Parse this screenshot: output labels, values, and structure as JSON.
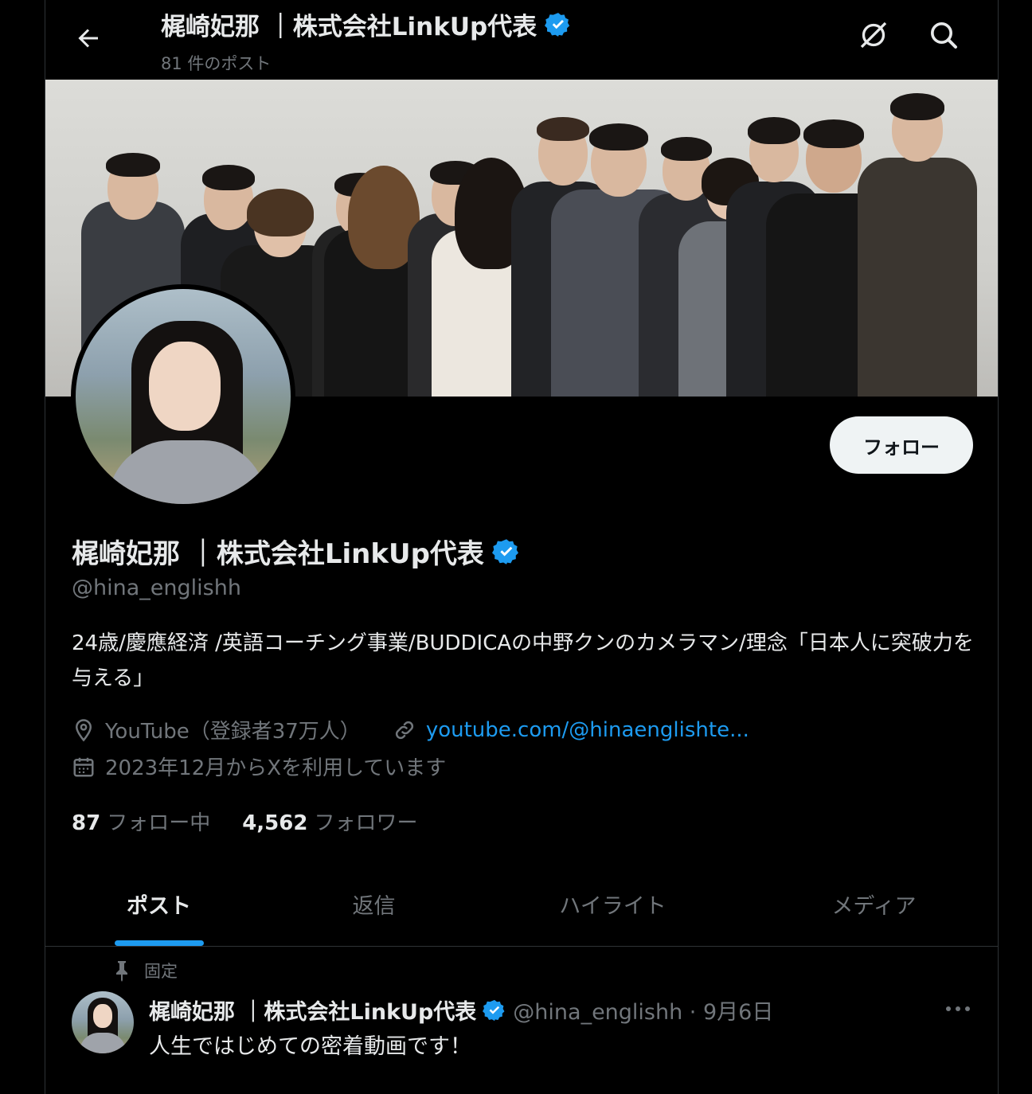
{
  "header": {
    "title": "梶崎妃那 ｜株式会社LinkUp代表",
    "post_count": "81 件のポスト",
    "back_icon": "arrow-left-icon",
    "grok_icon": "grok-icon",
    "search_icon": "search-icon"
  },
  "profile": {
    "name": "梶崎妃那 ｜株式会社LinkUp代表",
    "handle": "@hina_englishh",
    "bio": "24歳/慶應経済 /英語コーチング事業/BUDDICAの中野クンのカメラマン/理念「日本人に突破力を与える」",
    "location": "YouTube（登録者37万人）",
    "website": "youtube.com/@hinaenglishte...",
    "joined": "2023年12月からXを利用しています",
    "following_count": "87",
    "following_label": "フォロー中",
    "followers_count": "4,562",
    "followers_label": "フォロワー",
    "follow_button": "フォロー",
    "verified_color": "#1d9bf0"
  },
  "tabs": [
    {
      "label": "ポスト",
      "active": true
    },
    {
      "label": "返信",
      "active": false
    },
    {
      "label": "ハイライト",
      "active": false
    },
    {
      "label": "メディア",
      "active": false
    }
  ],
  "pinned_post": {
    "pinned_label": "固定",
    "author_name": "梶崎妃那 ｜株式会社LinkUp代表",
    "meta": "@hina_englishh · 9月6日",
    "text": "人生ではじめての密着動画です！"
  },
  "colors": {
    "background": "#000000",
    "accent": "#1d9bf0",
    "muted": "#71767b",
    "text": "#e7e9ea",
    "border": "#2f3336"
  }
}
